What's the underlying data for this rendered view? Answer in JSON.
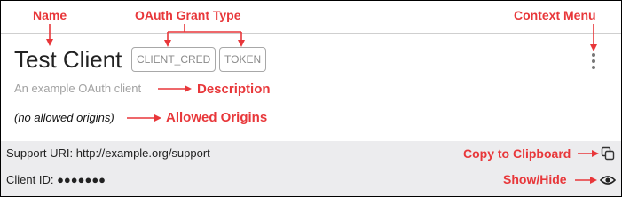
{
  "client": {
    "name": "Test Client",
    "grant_types": [
      "CLIENT_CRED",
      "TOKEN"
    ],
    "description": "An example OAuth client",
    "allowed_origins": "(no allowed origins)"
  },
  "footer": {
    "support_uri": "Support URI: http://example.org/support",
    "client_id": "Client ID: ●●●●●●●"
  },
  "annotations": {
    "name": "Name",
    "grant_type": "OAuth Grant Type",
    "context_menu": "Context Menu",
    "description": "Description",
    "allowed_origins": "Allowed Origins",
    "copy": "Copy to Clipboard",
    "show_hide": "Show/Hide"
  },
  "icons": {
    "menu": "kebab-menu-icon",
    "copy": "copy-icon",
    "visibility": "eye-icon"
  },
  "colors": {
    "annotation": "#e8373a",
    "footer_bg": "#ececee",
    "badge_border": "#a8a8a8",
    "muted_text": "#a2a2a2"
  }
}
